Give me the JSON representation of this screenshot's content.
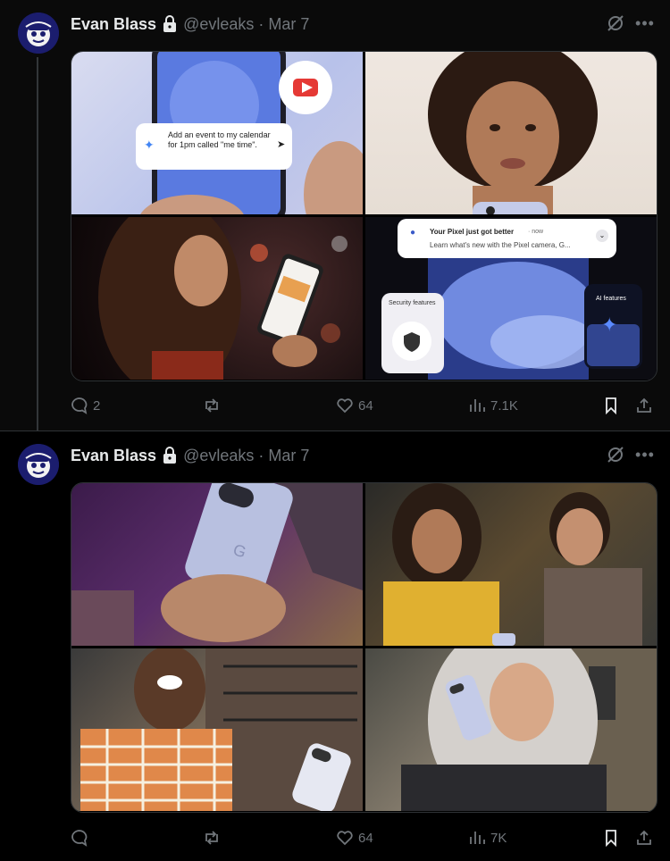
{
  "tweets": [
    {
      "author": {
        "name": "Evan Blass",
        "handle": "@evleaks",
        "separator": "·",
        "date": "Mar 7"
      },
      "media": {
        "overlay_texts": {
          "assistant_prompt": "Add an event to my calendar for 1pm called \"me time\".",
          "notification_title": "Your Pixel just got better",
          "notification_time": "· now",
          "notification_body": "Learn what's new with the Pixel camera, G...",
          "security_label": "Security features",
          "ai_label": "AI features"
        }
      },
      "actions": {
        "replies": "2",
        "reposts": "",
        "likes": "64",
        "views": "7.1K"
      }
    },
    {
      "author": {
        "name": "Evan Blass",
        "handle": "@evleaks",
        "separator": "·",
        "date": "Mar 7"
      },
      "actions": {
        "replies": "",
        "reposts": "",
        "likes": "64",
        "views": "7K"
      }
    }
  ],
  "colors": {
    "background": "#000000",
    "text": "#e7e9ea",
    "muted": "#71767b",
    "border": "#2f3336"
  },
  "icons": [
    "lock-icon",
    "grok-icon",
    "more-icon",
    "reply-icon",
    "repost-icon",
    "like-icon",
    "views-icon",
    "bookmark-icon",
    "share-icon"
  ]
}
